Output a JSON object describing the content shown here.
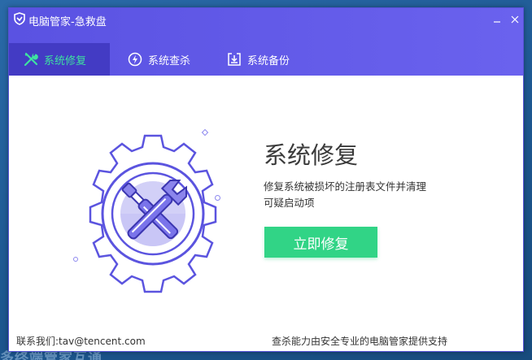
{
  "desktop": {
    "text": "多终端管家互通"
  },
  "window": {
    "title": "电脑管家-急救盘",
    "controls": {
      "minimize_icon": "minimize-icon",
      "close_icon": "close-icon"
    }
  },
  "tabs": [
    {
      "label": "系统修复",
      "icon": "tools-icon",
      "active": true
    },
    {
      "label": "系统查杀",
      "icon": "lightning-icon",
      "active": false
    },
    {
      "label": "系统备份",
      "icon": "backup-icon",
      "active": false
    }
  ],
  "main": {
    "heading": "系统修复",
    "description_line1": "修复系统被损坏的注册表文件并清理",
    "description_line2": "可疑启动项",
    "button_label": "立即修复"
  },
  "footer": {
    "contact": "联系我们:tav@tencent.com",
    "support": "查杀能力由安全专业的电脑管家提供支持"
  },
  "colors": {
    "titlebar": "#5a52e2",
    "active_tab": "#433bc4",
    "active_tab_text": "#3ee2a0",
    "button": "#31d486",
    "gear_stroke": "#5b54df",
    "gear_fill": "#c9c6f6"
  }
}
